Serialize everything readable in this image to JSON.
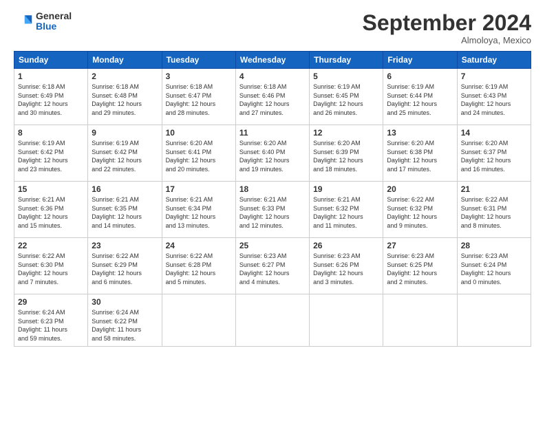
{
  "header": {
    "logo_general": "General",
    "logo_blue": "Blue",
    "month_title": "September 2024",
    "location": "Almoloya, Mexico"
  },
  "weekdays": [
    "Sunday",
    "Monday",
    "Tuesday",
    "Wednesday",
    "Thursday",
    "Friday",
    "Saturday"
  ],
  "weeks": [
    [
      {
        "day": "1",
        "sunrise": "6:18 AM",
        "sunset": "6:49 PM",
        "daylight": "12 hours and 30 minutes."
      },
      {
        "day": "2",
        "sunrise": "6:18 AM",
        "sunset": "6:48 PM",
        "daylight": "12 hours and 29 minutes."
      },
      {
        "day": "3",
        "sunrise": "6:18 AM",
        "sunset": "6:47 PM",
        "daylight": "12 hours and 28 minutes."
      },
      {
        "day": "4",
        "sunrise": "6:18 AM",
        "sunset": "6:46 PM",
        "daylight": "12 hours and 27 minutes."
      },
      {
        "day": "5",
        "sunrise": "6:19 AM",
        "sunset": "6:45 PM",
        "daylight": "12 hours and 26 minutes."
      },
      {
        "day": "6",
        "sunrise": "6:19 AM",
        "sunset": "6:44 PM",
        "daylight": "12 hours and 25 minutes."
      },
      {
        "day": "7",
        "sunrise": "6:19 AM",
        "sunset": "6:43 PM",
        "daylight": "12 hours and 24 minutes."
      }
    ],
    [
      {
        "day": "8",
        "sunrise": "6:19 AM",
        "sunset": "6:42 PM",
        "daylight": "12 hours and 23 minutes."
      },
      {
        "day": "9",
        "sunrise": "6:19 AM",
        "sunset": "6:42 PM",
        "daylight": "12 hours and 22 minutes."
      },
      {
        "day": "10",
        "sunrise": "6:20 AM",
        "sunset": "6:41 PM",
        "daylight": "12 hours and 20 minutes."
      },
      {
        "day": "11",
        "sunrise": "6:20 AM",
        "sunset": "6:40 PM",
        "daylight": "12 hours and 19 minutes."
      },
      {
        "day": "12",
        "sunrise": "6:20 AM",
        "sunset": "6:39 PM",
        "daylight": "12 hours and 18 minutes."
      },
      {
        "day": "13",
        "sunrise": "6:20 AM",
        "sunset": "6:38 PM",
        "daylight": "12 hours and 17 minutes."
      },
      {
        "day": "14",
        "sunrise": "6:20 AM",
        "sunset": "6:37 PM",
        "daylight": "12 hours and 16 minutes."
      }
    ],
    [
      {
        "day": "15",
        "sunrise": "6:21 AM",
        "sunset": "6:36 PM",
        "daylight": "12 hours and 15 minutes."
      },
      {
        "day": "16",
        "sunrise": "6:21 AM",
        "sunset": "6:35 PM",
        "daylight": "12 hours and 14 minutes."
      },
      {
        "day": "17",
        "sunrise": "6:21 AM",
        "sunset": "6:34 PM",
        "daylight": "12 hours and 13 minutes."
      },
      {
        "day": "18",
        "sunrise": "6:21 AM",
        "sunset": "6:33 PM",
        "daylight": "12 hours and 12 minutes."
      },
      {
        "day": "19",
        "sunrise": "6:21 AM",
        "sunset": "6:32 PM",
        "daylight": "12 hours and 11 minutes."
      },
      {
        "day": "20",
        "sunrise": "6:22 AM",
        "sunset": "6:32 PM",
        "daylight": "12 hours and 9 minutes."
      },
      {
        "day": "21",
        "sunrise": "6:22 AM",
        "sunset": "6:31 PM",
        "daylight": "12 hours and 8 minutes."
      }
    ],
    [
      {
        "day": "22",
        "sunrise": "6:22 AM",
        "sunset": "6:30 PM",
        "daylight": "12 hours and 7 minutes."
      },
      {
        "day": "23",
        "sunrise": "6:22 AM",
        "sunset": "6:29 PM",
        "daylight": "12 hours and 6 minutes."
      },
      {
        "day": "24",
        "sunrise": "6:22 AM",
        "sunset": "6:28 PM",
        "daylight": "12 hours and 5 minutes."
      },
      {
        "day": "25",
        "sunrise": "6:23 AM",
        "sunset": "6:27 PM",
        "daylight": "12 hours and 4 minutes."
      },
      {
        "day": "26",
        "sunrise": "6:23 AM",
        "sunset": "6:26 PM",
        "daylight": "12 hours and 3 minutes."
      },
      {
        "day": "27",
        "sunrise": "6:23 AM",
        "sunset": "6:25 PM",
        "daylight": "12 hours and 2 minutes."
      },
      {
        "day": "28",
        "sunrise": "6:23 AM",
        "sunset": "6:24 PM",
        "daylight": "12 hours and 0 minutes."
      }
    ],
    [
      {
        "day": "29",
        "sunrise": "6:24 AM",
        "sunset": "6:23 PM",
        "daylight": "11 hours and 59 minutes."
      },
      {
        "day": "30",
        "sunrise": "6:24 AM",
        "sunset": "6:22 PM",
        "daylight": "11 hours and 58 minutes."
      },
      null,
      null,
      null,
      null,
      null
    ]
  ]
}
